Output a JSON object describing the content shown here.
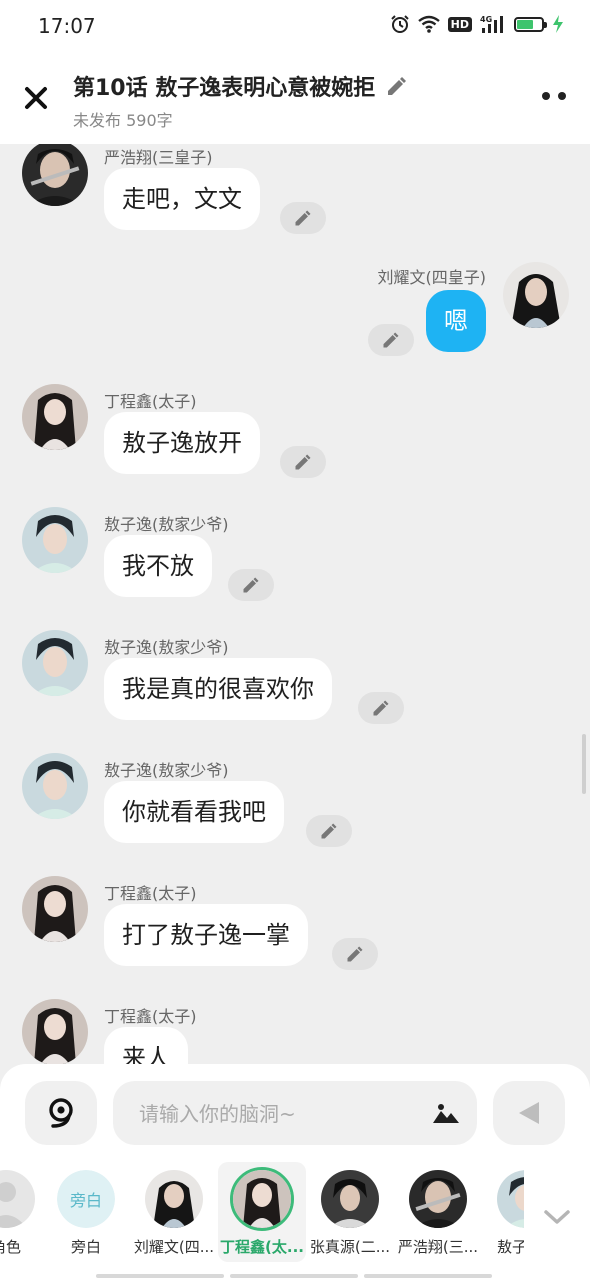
{
  "status_bar": {
    "time": "17:07",
    "network": "4G",
    "hd_label": "HD",
    "battery_percent": 70,
    "icons": [
      "alarm-icon",
      "wifi-icon",
      "hd-icon",
      "signal-icon",
      "battery-icon",
      "charging-icon"
    ]
  },
  "header": {
    "title": "第10话  敖子逸表明心意被婉拒",
    "subtitle": "未发布 590字",
    "close_icon": "close-icon",
    "edit_icon": "pencil-icon",
    "more_icon": "more-icon"
  },
  "messages": [
    {
      "speaker": "严浩翔(三皇子)",
      "text": "走吧，文文",
      "side": "left",
      "avatar": "yan"
    },
    {
      "speaker": "刘耀文(四皇子)",
      "text": "嗯",
      "side": "right",
      "avatar": "liu"
    },
    {
      "speaker": "丁程鑫(太子)",
      "text": "敖子逸放开",
      "side": "left",
      "avatar": "ding"
    },
    {
      "speaker": "敖子逸(敖家少爷)",
      "text": "我不放",
      "side": "left",
      "avatar": "ao"
    },
    {
      "speaker": "敖子逸(敖家少爷)",
      "text": "我是真的很喜欢你",
      "side": "left",
      "avatar": "ao"
    },
    {
      "speaker": "敖子逸(敖家少爷)",
      "text": "你就看看我吧",
      "side": "left",
      "avatar": "ao"
    },
    {
      "speaker": "丁程鑫(太子)",
      "text": "打了敖子逸一掌",
      "side": "left",
      "avatar": "ding"
    },
    {
      "speaker": "丁程鑫(太子)",
      "text": "来人",
      "side": "left",
      "avatar": "ding"
    }
  ],
  "composer": {
    "placeholder": "请输入你的脑洞~",
    "value": "",
    "voice_icon": "voice-icon",
    "image_icon": "image-icon",
    "send_icon": "send-icon"
  },
  "roles": [
    {
      "name": "角色",
      "selected": false
    },
    {
      "name": "旁白",
      "avatar_text": "旁白",
      "selected": false
    },
    {
      "name": "刘耀文(四...",
      "selected": false
    },
    {
      "name": "丁程鑫(太...",
      "selected": true
    },
    {
      "name": "张真源(二...",
      "selected": false
    },
    {
      "name": "严浩翔(三...",
      "selected": false
    },
    {
      "name": "敖子逸",
      "selected": false
    }
  ],
  "colors": {
    "accent_blue": "#1eb3f3",
    "selected_green": "#3dbb7a",
    "background": "#efefef"
  }
}
